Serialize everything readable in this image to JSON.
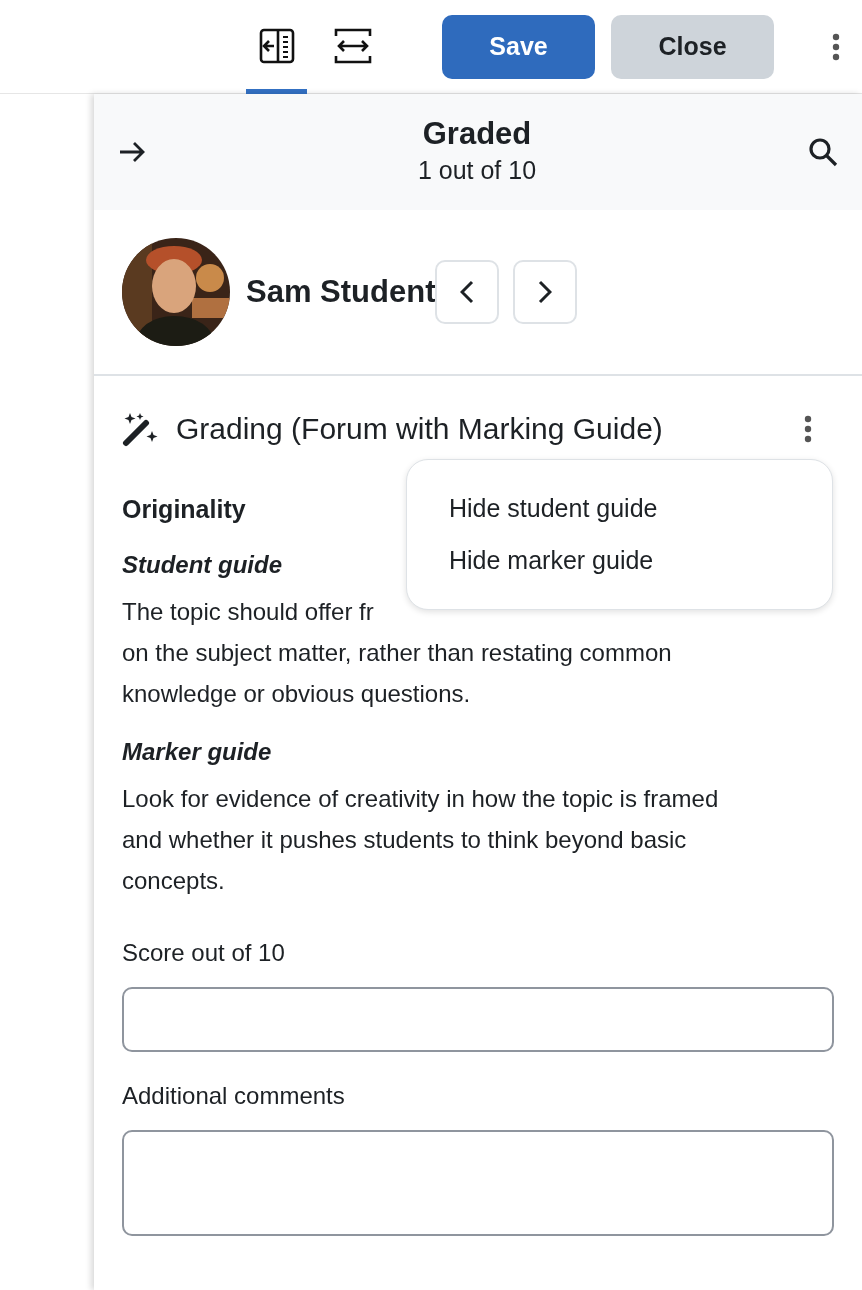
{
  "toolbar": {
    "view_tabs": [
      {
        "kind": "collapse-panel",
        "selected": true
      },
      {
        "kind": "fit-width",
        "selected": false
      }
    ],
    "buttons": [
      {
        "label": "Save",
        "kind": "primary"
      },
      {
        "label": "Close",
        "kind": "secondary"
      }
    ]
  },
  "panel": {
    "title": "Graded",
    "subtitle": "1 out of 10"
  },
  "student": {
    "name": "Sam Student"
  },
  "grading": {
    "title": "Grading (Forum with Marking Guide)",
    "menu": {
      "open": true,
      "items": [
        "Hide student guide",
        "Hide marker guide"
      ]
    },
    "criterion": "Originality",
    "student_guide": {
      "heading": "Student guide",
      "lines": [
        "The topic should offer fr",
        "on the subject matter, rather than restating common",
        "knowledge or obvious questions."
      ]
    },
    "marker_guide": {
      "heading": "Marker guide",
      "lines": [
        "Look for evidence of creativity in how the topic is framed",
        "and whether it pushes students to think beyond basic",
        "concepts."
      ]
    },
    "fields": [
      {
        "label": "Score out of 10",
        "kind": "input"
      },
      {
        "label": "Additional comments",
        "kind": "textarea"
      }
    ]
  }
}
